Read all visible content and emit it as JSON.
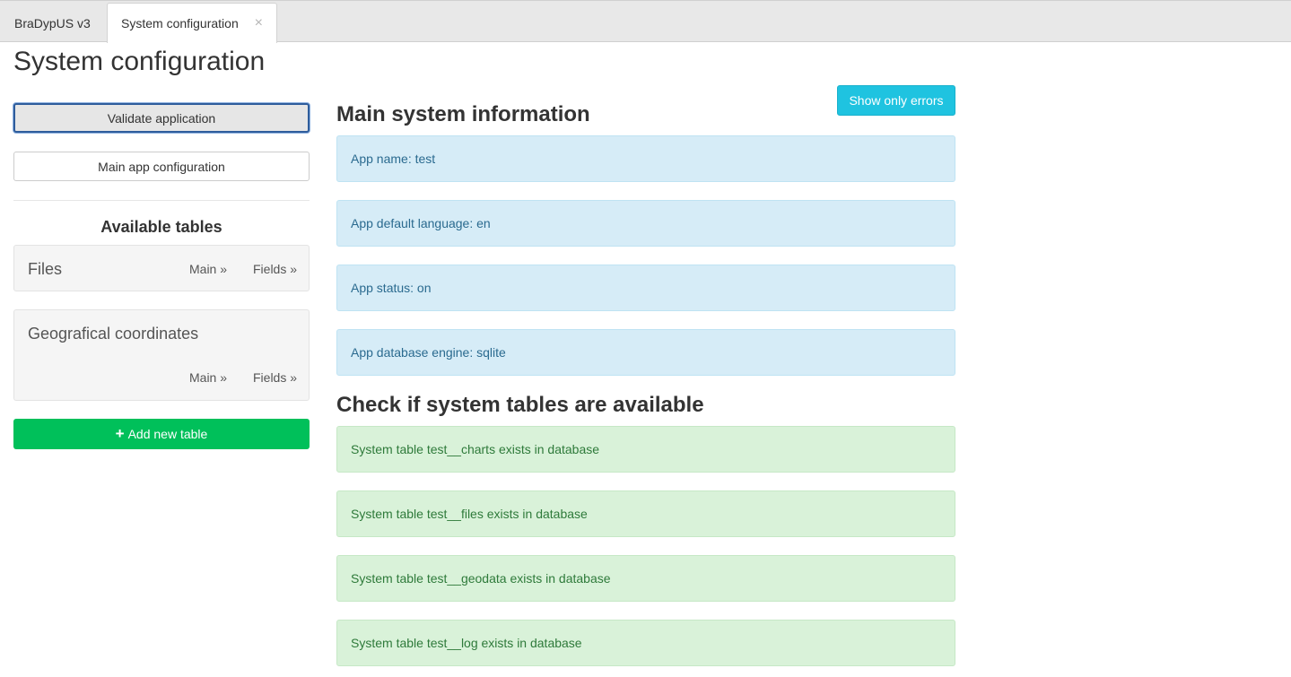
{
  "tabs": {
    "app_label": "BraDypUS v3",
    "active_label": "System configuration",
    "close_glyph": "×"
  },
  "page_title": "System configuration",
  "sidebar": {
    "validate_label": "Validate application",
    "main_conf_label": "Main app configuration",
    "available_tables_title": "Available tables",
    "tables": [
      {
        "name": "Files",
        "main_label": "Main »",
        "fields_label": "Fields »"
      },
      {
        "name": "Geografical coordinates",
        "main_label": "Main »",
        "fields_label": "Fields »"
      }
    ],
    "add_table_icon": "+",
    "add_table_label": "Add new table"
  },
  "main": {
    "show_errors_label": "Show only errors",
    "main_info_title": "Main system information",
    "info": [
      "App name: test",
      "App default language: en",
      "App status: on",
      "App database engine: sqlite"
    ],
    "check_title": "Check if system tables are available",
    "checks": [
      "System table test__charts exists in database",
      "System table test__files exists in database",
      "System table test__geodata exists in database",
      "System table test__log exists in database"
    ]
  },
  "colors": {
    "info_bg": "#d6ecf7",
    "success_bg": "#d9f2d9",
    "add_button": "#00c05a",
    "errors_button": "#1fc3e0"
  }
}
